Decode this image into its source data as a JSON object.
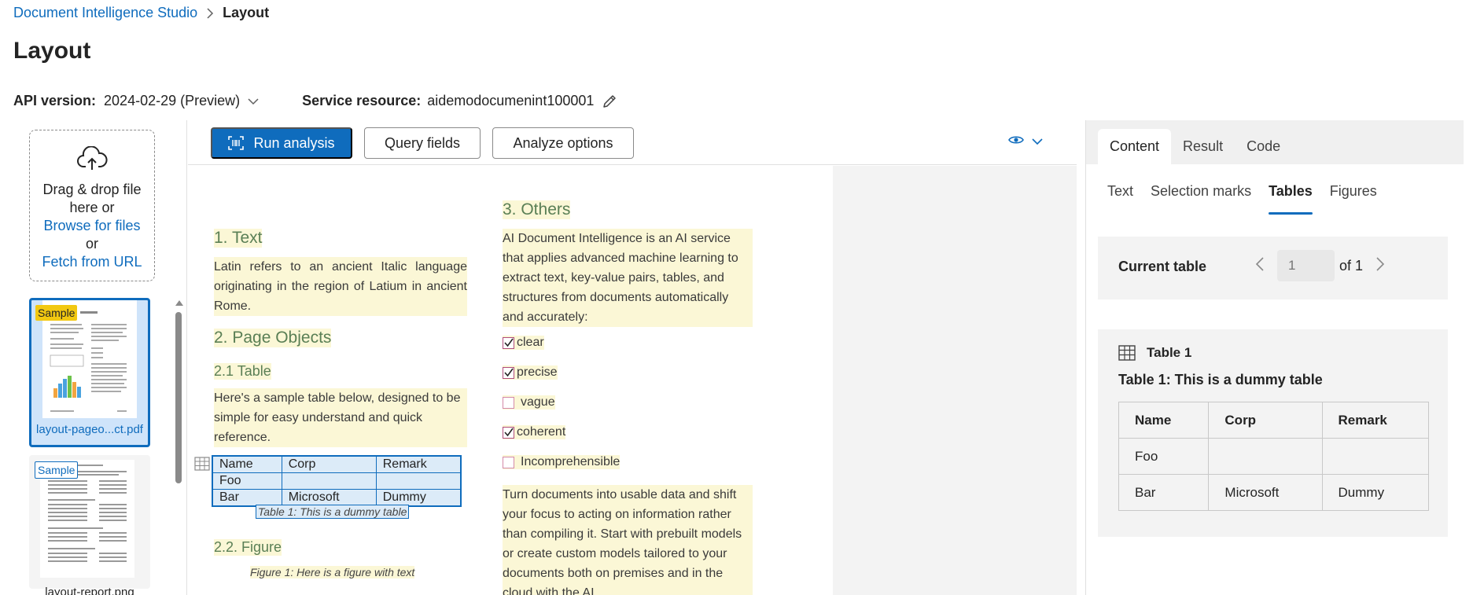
{
  "breadcrumb": {
    "root": "Document Intelligence Studio",
    "current": "Layout"
  },
  "page_title": "Layout",
  "api": {
    "label": "API version:",
    "value": "2024-02-29 (Preview)",
    "service_label": "Service resource:",
    "service_value": "aidemodocumenint100001"
  },
  "upload": {
    "line1": "Drag & drop file",
    "line2": "here or",
    "browse": "Browse for files",
    "or": "or",
    "fetch": "Fetch from URL"
  },
  "files": [
    {
      "badge": "Sample",
      "name": "layout-pageo...ct.pdf",
      "selected": true
    },
    {
      "badge": "Sample",
      "name": "layout-report.png",
      "selected": false
    }
  ],
  "toolbar": {
    "run": "Run analysis",
    "query": "Query fields",
    "options": "Analyze options"
  },
  "document": {
    "h_text": "1. Text",
    "p_text": "Latin refers to an ancient Italic language originating in the region of Latium in ancient Rome.",
    "h_page_objects": "2. Page Objects",
    "h_table": "2.1 Table",
    "p_table": "Here's a sample table below, designed to be simple for easy understand and quick reference.",
    "table": {
      "rows": [
        [
          "Name",
          "Corp",
          "Remark"
        ],
        [
          "Foo",
          "",
          ""
        ],
        [
          "Bar",
          "Microsoft",
          "Dummy"
        ]
      ]
    },
    "table_caption": "Table 1: This is a dummy table",
    "h_figure": "2.2. Figure",
    "figure_caption": "Figure 1: Here is a figure with text",
    "h_others": "3. Others",
    "p_others": "AI Document Intelligence is an AI service that applies advanced machine learning to extract text, key-value pairs, tables, and structures from documents automatically and accurately:",
    "checks": [
      {
        "label": "clear",
        "checked": true
      },
      {
        "label": "precise",
        "checked": true
      },
      {
        "label": "vague",
        "checked": false
      },
      {
        "label": "coherent",
        "checked": true
      },
      {
        "label": "Incomprehensible",
        "checked": false
      }
    ],
    "p_turn": "Turn documents into usable data and shift your focus to acting on information rather than compiling it. Start with prebuilt models or create custom models tailored to your documents both on premises and in the cloud with the AI"
  },
  "right": {
    "tabs": [
      "Content",
      "Result",
      "Code"
    ],
    "active_tab": "Content",
    "sub_tabs": [
      "Text",
      "Selection marks",
      "Tables",
      "Figures"
    ],
    "active_sub_tab": "Tables",
    "current_table_label": "Current table",
    "page_placeholder": "1",
    "page_of": "of 1",
    "table_title": "Table 1",
    "table_caption": "Table 1: This is a dummy table",
    "table_headers": [
      "Name",
      "Corp",
      "Remark"
    ],
    "table_rows": [
      [
        "Foo",
        "",
        ""
      ],
      [
        "Bar",
        "Microsoft",
        "Dummy"
      ]
    ]
  },
  "colors": {
    "accent": "#0f6cbd",
    "sample_badge": "#f2c811",
    "highlight": "#fbf7d6",
    "heading_green": "#5a7f55"
  },
  "icons": [
    "chevron-right-icon",
    "chevron-down-icon",
    "pencil-icon",
    "cloud-upload-icon",
    "scan-icon",
    "eye-icon",
    "table-icon",
    "chevron-left-icon",
    "arrow-up-icon"
  ]
}
